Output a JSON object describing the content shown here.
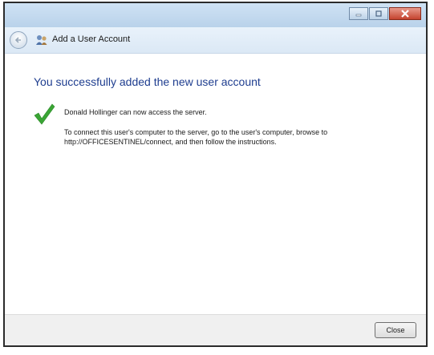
{
  "window": {
    "title": "Add a User Account",
    "controls": [
      "minimize-icon",
      "maximize-icon",
      "close-icon"
    ]
  },
  "nav": {
    "back_icon": "back-arrow-icon",
    "app_icon": "users-icon",
    "title": "Add a User Account"
  },
  "main": {
    "heading": "You successfully added the new user account",
    "status_icon": "checkmark-icon",
    "message": "Donald Hollinger can now access the server.",
    "instructions": "To connect this user's computer to the server, go to the user's computer, browse to http://OFFICESENTINEL/connect, and then follow the instructions."
  },
  "footer": {
    "close_label": "Close"
  },
  "colors": {
    "heading": "#1e3d8f",
    "titlebar": "#b9d2ea",
    "check": "#3aa535",
    "close_button": "#c4432e"
  }
}
